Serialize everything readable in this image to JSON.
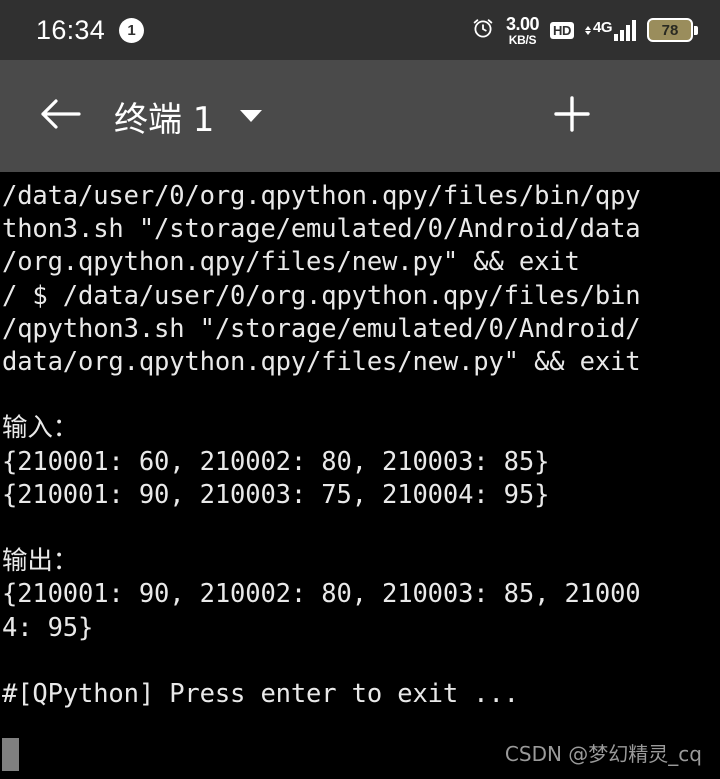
{
  "status_bar": {
    "time": "16:34",
    "notification_count": "1",
    "alarm_icon": "alarm-clock-icon",
    "network_speed_value": "3.00",
    "network_speed_unit": "KB/S",
    "hd_label": "HD",
    "network_type": "4G",
    "signal_bars": 4,
    "battery_percent": "78",
    "colors": {
      "background": "#303030",
      "foreground": "#ffffff",
      "battery_fill": "#9a8d5c"
    }
  },
  "app_bar": {
    "back_icon": "arrow-left-icon",
    "title": "终端 1",
    "dropdown_icon": "chevron-down-icon",
    "add_icon": "plus-icon",
    "overflow_icon": "more-vertical-icon",
    "colors": {
      "background": "#4a4a4a",
      "foreground": "#ffffff"
    }
  },
  "terminal": {
    "colors": {
      "background": "#000000",
      "foreground": "#e9e9e9",
      "cursor": "#808080"
    },
    "lines": [
      "/data/user/0/org.qpython.qpy/files/bin/qpy",
      "thon3.sh \"/storage/emulated/0/Android/data",
      "/org.qpython.qpy/files/new.py\" && exit",
      "/ $ /data/user/0/org.qpython.qpy/files/bin",
      "/qpython3.sh \"/storage/emulated/0/Android/",
      "data/org.qpython.qpy/files/new.py\" && exit",
      "",
      "输入：",
      "{210001: 60, 210002: 80, 210003: 85}",
      "{210001: 90, 210003: 75, 210004: 95}",
      "",
      "输出：",
      "{210001: 90, 210002: 80, 210003: 85, 21000",
      "4: 95}",
      "",
      "#[QPython] Press enter to exit ..."
    ]
  },
  "watermark": {
    "text": "CSDN @梦幻精灵_cq"
  }
}
